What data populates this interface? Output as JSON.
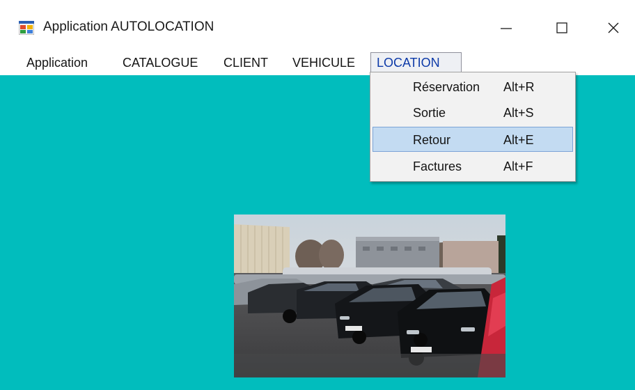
{
  "window": {
    "title": "Application AUTOLOCATION",
    "icon": "windows-form-icon",
    "controls": [
      "minimize-icon",
      "maximize-icon",
      "close-icon"
    ]
  },
  "menubar": {
    "items": [
      {
        "label": "Application"
      },
      {
        "label": "CATALOGUE"
      },
      {
        "label": "CLIENT"
      },
      {
        "label": "VEHICULE"
      },
      {
        "label": "LOCATION",
        "open": true
      }
    ]
  },
  "location_menu": {
    "items": [
      {
        "label": "Réservation",
        "shortcut": "Alt+R"
      },
      {
        "label": "Sortie",
        "shortcut": "Alt+S"
      },
      {
        "label": "Retour",
        "shortcut": "Alt+E",
        "highlighted": true
      },
      {
        "label": "Factures",
        "shortcut": "Alt+F"
      }
    ]
  },
  "colors": {
    "client_background": "#01bdbd",
    "menu_highlight": "#c3dbf2",
    "open_menu_text": "#0d3aa8"
  }
}
